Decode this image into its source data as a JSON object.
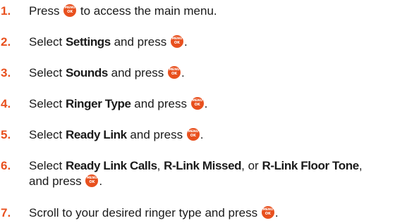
{
  "steps": [
    {
      "number": "1.",
      "pre": "Press ",
      "post": " to access the main menu."
    },
    {
      "number": "2.",
      "pre": "Select ",
      "bold": "Settings",
      "post": " and press ",
      "end": "."
    },
    {
      "number": "3.",
      "pre": "Select ",
      "bold": "Sounds",
      "post": " and press ",
      "end": "."
    },
    {
      "number": "4.",
      "pre": "Select ",
      "bold": "Ringer Type",
      "post": " and press ",
      "end": "."
    },
    {
      "number": "5.",
      "pre": "Select ",
      "bold": "Ready Link",
      "post": " and press ",
      "end": "."
    },
    {
      "number": "6.",
      "pre": "Select ",
      "bold1": "Ready Link Calls",
      "sep1": ", ",
      "bold2": "R-Link Missed",
      "sep2": ", or ",
      "bold3": "R-Link Floor Tone",
      "sep3": ",",
      "line2_pre": "and press ",
      "end": "."
    },
    {
      "number": "7.",
      "pre": "Scroll to your desired ringer type and press ",
      "end": "."
    }
  ],
  "key_icon": "menu-ok-key-icon",
  "accent_color": "#e8501e"
}
